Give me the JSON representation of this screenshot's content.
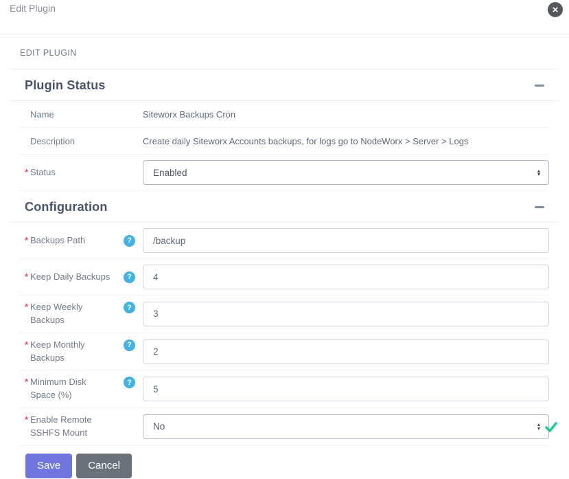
{
  "modal": {
    "title": "Edit Plugin"
  },
  "page_header": {
    "label": "EDIT PLUGIN"
  },
  "misc": {
    "required_marker": "*",
    "help_glyph": "?",
    "close_glyph": "×",
    "arrow_up": "▴",
    "arrow_down": "▾"
  },
  "plugin_status": {
    "heading": "Plugin Status",
    "name_label": "Name",
    "name_value": "Siteworx Backups Cron",
    "description_label": "Description",
    "description_value": "Create daily Siteworx Accounts backups, for logs go to NodeWorx > Server > Logs",
    "status_label": "Status",
    "status_value": "Enabled"
  },
  "configuration": {
    "heading": "Configuration",
    "fields": [
      {
        "label": "Backups Path",
        "value": "/backup",
        "control": "text",
        "help": true
      },
      {
        "label": "Keep Daily Backups",
        "value": "4",
        "control": "text",
        "help": true
      },
      {
        "label": "Keep Weekly Backups",
        "value": "3",
        "control": "text",
        "help": true
      },
      {
        "label": "Keep Monthly Backups",
        "value": "2",
        "control": "text",
        "help": true
      },
      {
        "label": "Minimum Disk Space (%)",
        "value": "5",
        "control": "text",
        "help": true
      },
      {
        "label": "Enable Remote SSHFS Mount",
        "value": "No",
        "control": "select",
        "help": false,
        "validated": true
      }
    ]
  },
  "actions": {
    "save_label": "Save",
    "cancel_label": "Cancel"
  },
  "colors": {
    "help_blue": "#41b2e1",
    "valid_green": "#1ecb8e",
    "required_red": "#e8506e",
    "save_purple": "#7076e0",
    "cancel_gray": "#6a7178",
    "heading_navy": "#49536a"
  }
}
